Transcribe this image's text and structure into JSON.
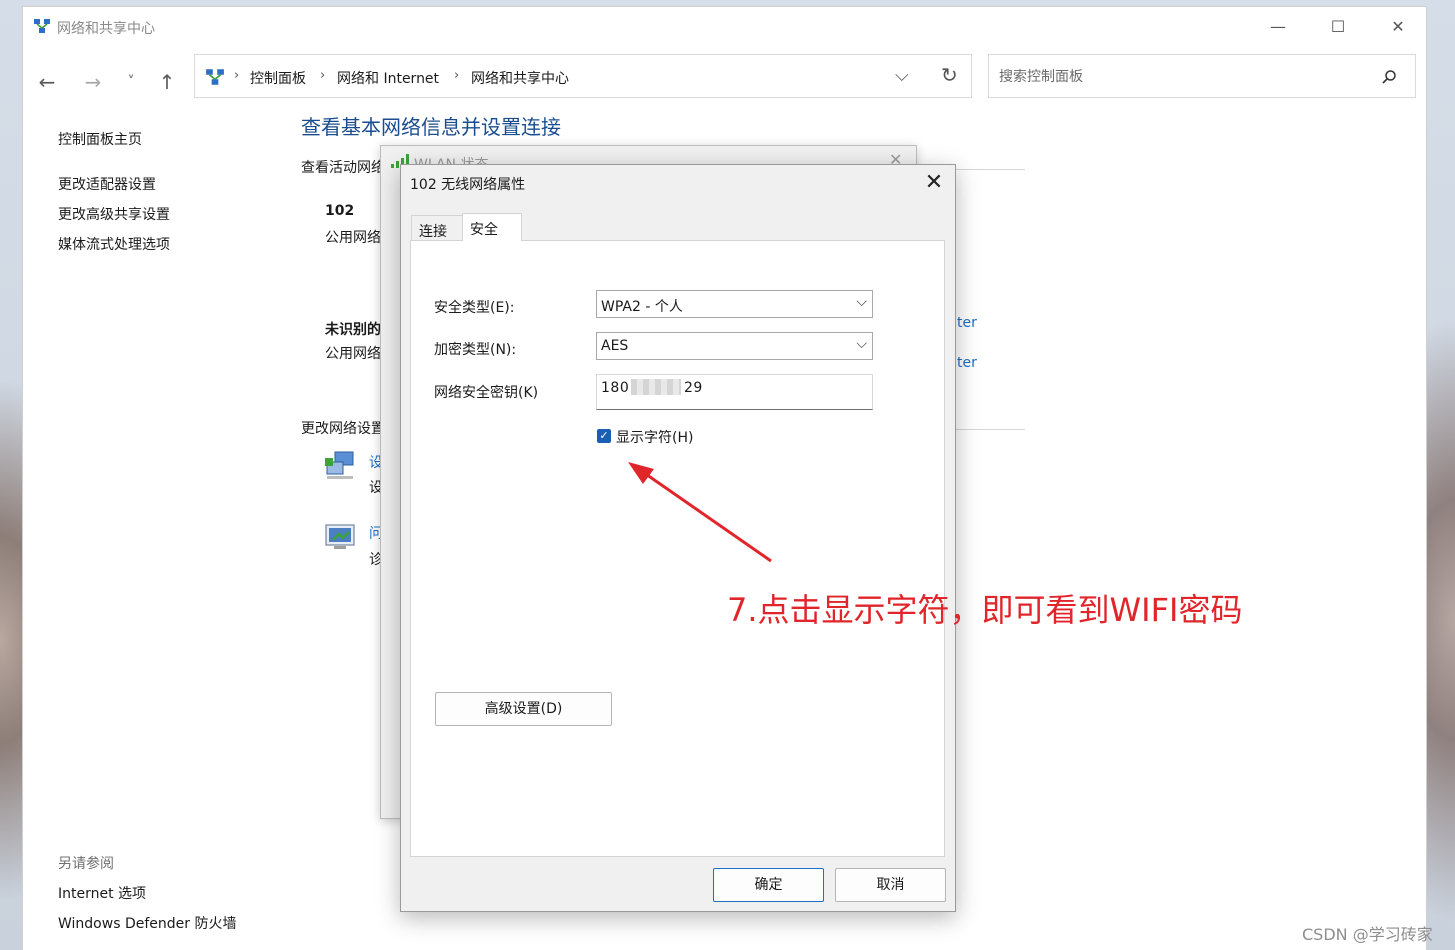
{
  "window": {
    "title": "网络和共享中心",
    "minimize": "—",
    "maximize": "☐",
    "close": "✕"
  },
  "nav": {
    "back": "←",
    "forward": "→",
    "recent": "˅",
    "up": "↑",
    "dropdown": "⌵",
    "refresh": "↻"
  },
  "breadcrumb": {
    "items": [
      "控制面板",
      "网络和 Internet",
      "网络和共享中心"
    ],
    "separator": "›"
  },
  "search": {
    "placeholder": "搜索控制面板"
  },
  "sidebar": {
    "items": [
      "控制面板主页",
      "更改适配器设置",
      "更改高级共享设置",
      "媒体流式处理选项"
    ],
    "see_also_title": "另请参阅",
    "see_also": [
      "Internet 选项",
      "Windows Defender 防火墙"
    ]
  },
  "main": {
    "title": "查看基本网络信息并设置连接",
    "active_networks_label": "查看活动网络",
    "networks": [
      {
        "name": "102",
        "type": "公用网络"
      },
      {
        "name": "未识别的",
        "type": "公用网络"
      }
    ],
    "link_fragments": [
      "ter",
      "ter"
    ],
    "change_settings_label": "更改网络设置",
    "tasks": [
      {
        "title": "设",
        "desc": "设"
      },
      {
        "title": "问",
        "desc": "诊"
      }
    ]
  },
  "wlan_status": {
    "title": "WLAN 状态"
  },
  "dialog": {
    "title": "102 无线网络属性",
    "close": "✕",
    "tabs": [
      "连接",
      "安全"
    ],
    "active_tab": "安全",
    "security_type_label": "安全类型(E):",
    "security_type_value": "WPA2 - 个人",
    "encryption_type_label": "加密类型(N):",
    "encryption_type_value": "AES",
    "key_label": "网络安全密钥(K)",
    "key_value_start": "180",
    "key_value_end": "29",
    "show_chars_label": "显示字符(H)",
    "show_chars_checked": true,
    "advanced_button": "高级设置(D)",
    "ok_button": "确定",
    "cancel_button": "取消"
  },
  "annotation": {
    "text": "7.点击显示字符，即可看到WIFI密码",
    "color": "#e0262a"
  },
  "watermark": "CSDN @学习砖家"
}
